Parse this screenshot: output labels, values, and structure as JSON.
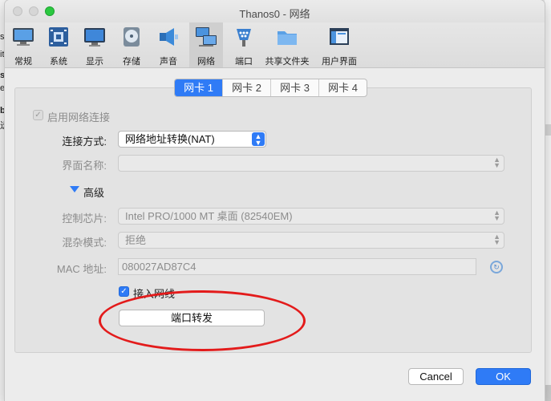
{
  "window": {
    "title": "Thanos0 - 网络"
  },
  "toolbar": {
    "items": [
      {
        "label": "常规",
        "icon": "general-monitor-icon"
      },
      {
        "label": "系统",
        "icon": "system-chip-icon"
      },
      {
        "label": "显示",
        "icon": "display-monitor-icon"
      },
      {
        "label": "存储",
        "icon": "storage-disk-icon"
      },
      {
        "label": "声音",
        "icon": "sound-speaker-icon"
      },
      {
        "label": "网络",
        "icon": "network-icon"
      },
      {
        "label": "端口",
        "icon": "serial-port-icon"
      },
      {
        "label": "共享文件夹",
        "icon": "shared-folder-icon"
      },
      {
        "label": "用户界面",
        "icon": "user-interface-icon"
      }
    ],
    "selected": "网络"
  },
  "tabs": [
    "网卡 1",
    "网卡 2",
    "网卡 3",
    "网卡 4"
  ],
  "active_tab": "网卡 1",
  "form": {
    "enable_network": {
      "label": "启用网络连接",
      "checked": true
    },
    "attached_to": {
      "label": "连接方式:",
      "value": "网络地址转换(NAT)"
    },
    "interface_name": {
      "label": "界面名称:",
      "value": ""
    },
    "advanced": {
      "label": "高级"
    },
    "adapter_type": {
      "label": "控制芯片:",
      "value": "Intel PRO/1000 MT 桌面 (82540EM)"
    },
    "promiscuous": {
      "label": "混杂模式:",
      "value": "拒绝"
    },
    "mac": {
      "label": "MAC 地址:",
      "value": "080027AD87C4"
    },
    "cable_connected": {
      "label": "接入网线",
      "checked": true
    },
    "port_forwarding": {
      "label": "端口转发"
    }
  },
  "footer": {
    "cancel": "Cancel",
    "ok": "OK"
  },
  "background_fragments": [
    "s",
    "it",
    "s",
    "ep",
    "b",
    "送"
  ],
  "colors": {
    "accent": "#2f7bf6",
    "annotation": "#e31b1b"
  }
}
